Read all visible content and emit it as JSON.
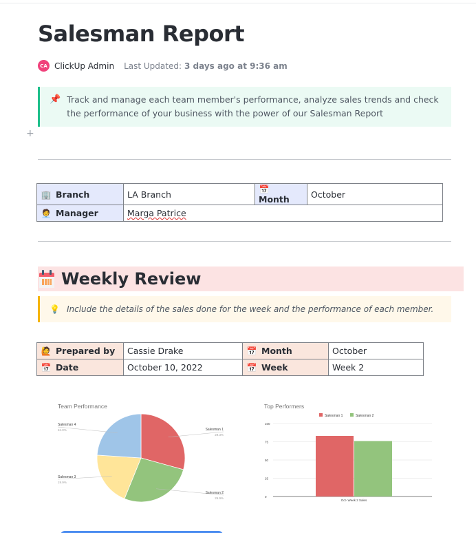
{
  "page": {
    "title": "Salesman Report",
    "author": {
      "initials": "CA",
      "name": "ClickUp Admin",
      "avatar_color": "#f0417b"
    },
    "last_updated_label": "Last Updated:",
    "last_updated_value": "3 days ago at 9:36 am"
  },
  "intro_callout": {
    "icon": "pushpin-icon",
    "text": "Track and manage each team member's performance, analyze sales trends and check the performance of your business with the power of our Salesman Report"
  },
  "branch_table": {
    "rows": [
      {
        "label": "Branch",
        "icon": "office-building-icon",
        "value": "LA Branch",
        "label2": "Month",
        "icon2": "calendar-icon",
        "value2": "October"
      },
      {
        "label": "Manager",
        "icon": "person-icon",
        "value": "Marga Patrice"
      }
    ]
  },
  "weekly_review": {
    "heading": "Weekly Review",
    "icon": "calendar-icon",
    "note_icon": "lightbulb-icon",
    "note": "Include the details of the sales done for the week and the performance of each member.",
    "table": {
      "rows": [
        {
          "label": "Prepared by",
          "icon": "person-raising-hand-icon",
          "value": "Cassie Drake",
          "label2": "Month",
          "icon2": "calendar-icon",
          "value2": "October"
        },
        {
          "label": "Date",
          "icon": "calendar-icon",
          "value": "October 10, 2022",
          "label2": "Week",
          "icon2": "calendar-icon",
          "value2": "Week 2"
        }
      ]
    }
  },
  "chart_data": [
    {
      "type": "pie",
      "title": "Team Performance",
      "categories": [
        "Salesman 1",
        "Salesman 2",
        "Salesman 3",
        "Salesman 4"
      ],
      "values": [
        29.3,
        26.9,
        19.9,
        24.0
      ],
      "labels": [
        "29.3%",
        "26.9%",
        "19.9%",
        "24.0%"
      ],
      "colors": [
        "#e06666",
        "#93c47d",
        "#ffe599",
        "#9fc5e8"
      ],
      "legend": "labeled-slices"
    },
    {
      "type": "bar",
      "title": "Top Performers",
      "categories": [
        "Oct- Week 2 Sales"
      ],
      "series": [
        {
          "name": "Salesman 1",
          "values": [
            83
          ],
          "color": "#e06666"
        },
        {
          "name": "Salesman 2",
          "values": [
            76
          ],
          "color": "#93c47d"
        }
      ],
      "xlabel": "",
      "ylabel": "",
      "ylim": [
        0,
        100
      ],
      "yticks": [
        "0",
        "25",
        "50",
        "75",
        "100"
      ],
      "grid": true,
      "legend": "top-center"
    }
  ]
}
